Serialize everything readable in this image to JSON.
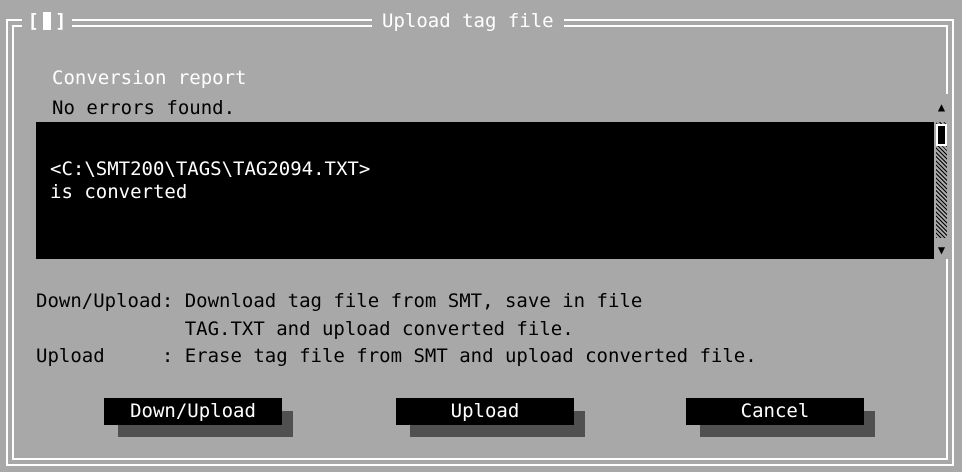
{
  "window": {
    "close_glyph": "[■]",
    "title": "Upload tag file"
  },
  "report": {
    "label": "Conversion report",
    "status": "No errors found.",
    "log_lines": [
      "<C:\\SMT200\\TAGS\\TAG2094.TXT>",
      "is converted"
    ]
  },
  "help": {
    "line1": "Down/Upload: Download tag file from SMT, save in file",
    "line2": "             TAG.TXT and upload converted file.",
    "line3": "Upload     : Erase tag file from SMT and upload converted file."
  },
  "buttons": {
    "down_upload": "Down/Upload",
    "upload": "Upload",
    "cancel": "Cancel"
  },
  "colors": {
    "dialog_bg": "#a8a8a8",
    "frame": "#ffffff",
    "log_bg": "#000000",
    "button_bg": "#000000",
    "button_shadow": "#505050"
  },
  "icons": {
    "close": "close-box-icon",
    "scroll_up": "scroll-up-arrow-icon",
    "scroll_down": "scroll-down-arrow-icon"
  }
}
